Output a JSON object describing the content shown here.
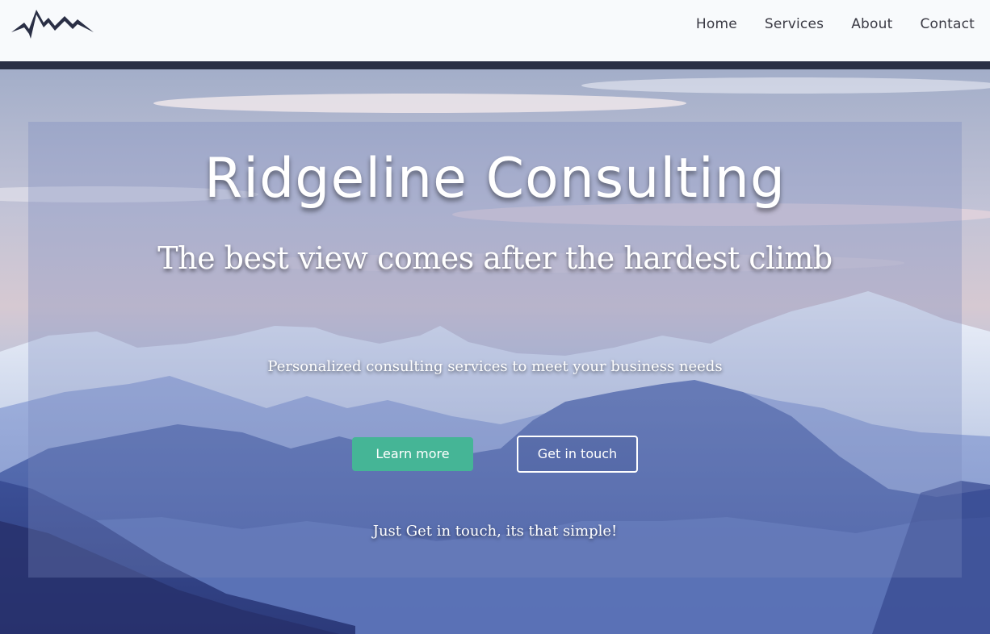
{
  "nav": {
    "logo_icon": "mountain-logo-icon",
    "links": [
      "Home",
      "Services",
      "About",
      "Contact"
    ]
  },
  "hero": {
    "title": "Ridgeline Consulting",
    "tagline": "The best view comes after the hardest climb",
    "subtitle": "Personalized consulting services to meet your business needs",
    "primary_button": "Learn more",
    "secondary_button": "Get in touch",
    "footer_text": "Just Get in touch, its that simple!"
  },
  "colors": {
    "nav_bg": "#f8fafc",
    "divider": "#2a2f45",
    "primary_button": "#45b596",
    "text": "#ffffff",
    "logo": "#2a2f45"
  }
}
